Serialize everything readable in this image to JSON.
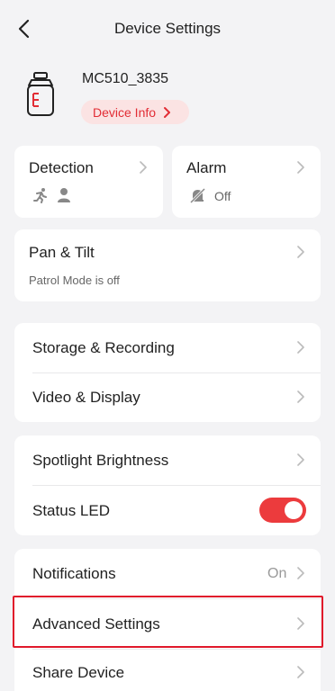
{
  "header": {
    "title": "Device Settings"
  },
  "device": {
    "name": "MC510_3835",
    "info_label": "Device Info"
  },
  "detection": {
    "label": "Detection"
  },
  "alarm": {
    "label": "Alarm",
    "status": "Off"
  },
  "pan_tilt": {
    "label": "Pan & Tilt",
    "subtitle": "Patrol Mode is off"
  },
  "storage": {
    "label": "Storage & Recording"
  },
  "video": {
    "label": "Video & Display"
  },
  "spotlight": {
    "label": "Spotlight Brightness"
  },
  "status_led": {
    "label": "Status LED",
    "enabled": true
  },
  "notifications": {
    "label": "Notifications",
    "value": "On"
  },
  "advanced": {
    "label": "Advanced Settings"
  },
  "share": {
    "label": "Share Device"
  },
  "colors": {
    "accent": "#ec3b3d",
    "highlight": "#e0192b",
    "background": "#f3f3f5"
  }
}
